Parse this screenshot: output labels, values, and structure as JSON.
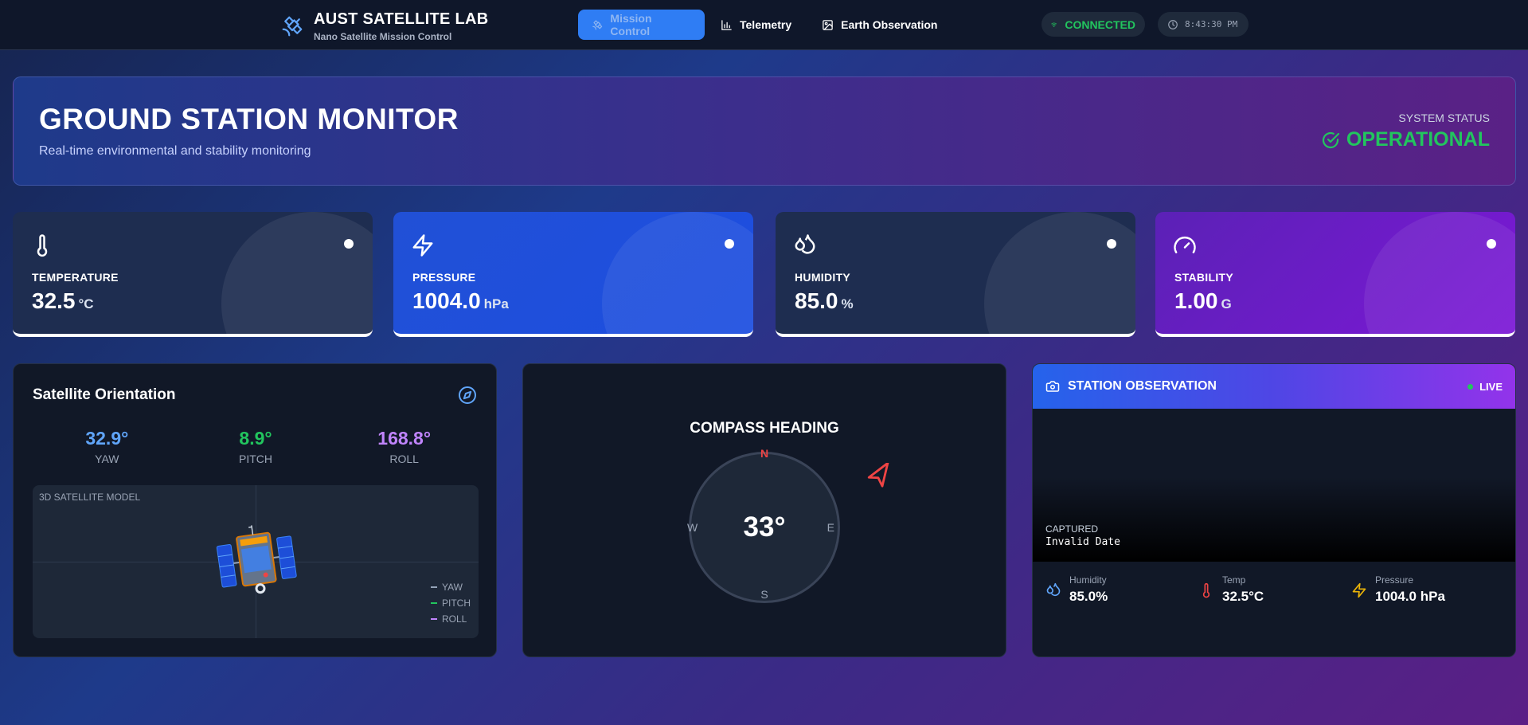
{
  "header": {
    "brand_title": "AUST SATELLITE LAB",
    "brand_subtitle": "Nano Satellite Mission Control",
    "nav": [
      {
        "label": "Mission Control",
        "icon": "satellite-icon",
        "active": true
      },
      {
        "label": "Telemetry",
        "icon": "bar-chart-icon",
        "active": false
      },
      {
        "label": "Earth Observation",
        "icon": "image-icon",
        "active": false
      }
    ],
    "connection_status": "CONNECTED",
    "clock": "8:43:30 PM"
  },
  "hero": {
    "title": "GROUND STATION MONITOR",
    "subtitle": "Real-time environmental and stability monitoring",
    "status_label": "SYSTEM STATUS",
    "status_value": "OPERATIONAL"
  },
  "stats": [
    {
      "label": "TEMPERATURE",
      "value": "32.5",
      "unit": "°C",
      "icon": "thermometer-icon"
    },
    {
      "label": "PRESSURE",
      "value": "1004.0",
      "unit": "hPa",
      "icon": "zap-icon"
    },
    {
      "label": "HUMIDITY",
      "value": "85.0",
      "unit": "%",
      "icon": "droplets-icon"
    },
    {
      "label": "STABILITY",
      "value": "1.00",
      "unit": "G",
      "icon": "gauge-icon"
    }
  ],
  "orientation": {
    "title": "Satellite Orientation",
    "yaw": "32.9°",
    "yaw_label": "YAW",
    "pitch": "8.9°",
    "pitch_label": "PITCH",
    "roll": "168.8°",
    "roll_label": "ROLL",
    "model_label": "3D SATELLITE MODEL",
    "legend": [
      "YAW",
      "PITCH",
      "ROLL"
    ]
  },
  "compass": {
    "title": "COMPASS HEADING",
    "heading": "33°",
    "north": "N",
    "south": "S",
    "east": "E",
    "west": "W"
  },
  "observation": {
    "title": "STATION OBSERVATION",
    "live": "LIVE",
    "captured_label": "CAPTURED",
    "captured_value": "Invalid Date",
    "readings": [
      {
        "label": "Humidity",
        "value": "85.0%",
        "icon": "droplets-icon"
      },
      {
        "label": "Temp",
        "value": "32.5°C",
        "icon": "thermometer-icon"
      },
      {
        "label": "Pressure",
        "value": "1004.0 hPa",
        "icon": "zap-icon"
      }
    ]
  },
  "colors": {
    "accent_blue": "#2f7df4",
    "success_green": "#22c55e",
    "yaw": "#60a5fa",
    "pitch": "#22c55e",
    "roll": "#c084fc",
    "north": "#ef4444"
  }
}
